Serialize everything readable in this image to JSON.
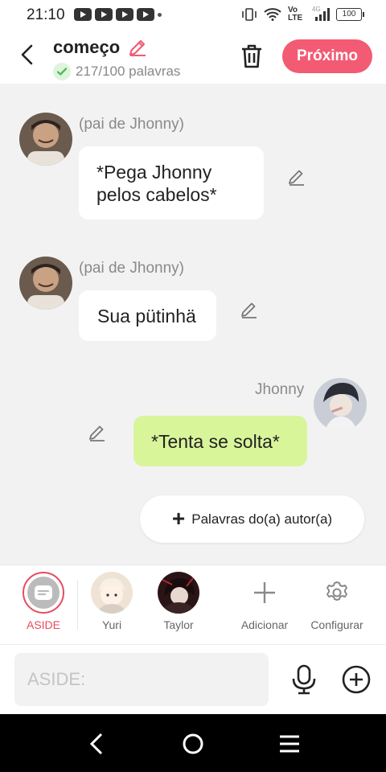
{
  "status": {
    "time": "21:10",
    "network": "Vo LTE",
    "signal": "4G",
    "battery": "100"
  },
  "header": {
    "title": "começo",
    "word_count": "217/100 palavras",
    "next_label": "Próximo"
  },
  "messages": [
    {
      "name": "(pai de Jhonny)",
      "text": "*Pega Jhonny pelos cabelos*"
    },
    {
      "name": "(pai de Jhonny)",
      "text": "Sua pütinhä"
    },
    {
      "name": "Jhonny",
      "text": "*Tenta se solta*"
    }
  ],
  "add_words_label": "Palavras do(a) autor(a)",
  "characters": {
    "aside": "ASIDE",
    "yuri": "Yuri",
    "taylor": "Taylor",
    "add": "Adicionar",
    "settings": "Configurar"
  },
  "input": {
    "placeholder": "ASIDE:"
  },
  "colors": {
    "accent": "#f25b73",
    "my_bubble": "#d9f59a",
    "background": "#f2f2f2"
  }
}
